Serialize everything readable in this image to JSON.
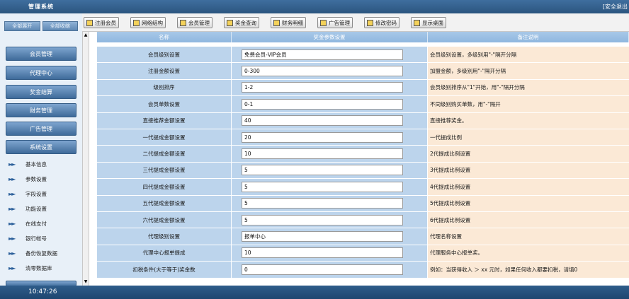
{
  "app": {
    "title": "管理系统",
    "logout": "[安全退出"
  },
  "left_top_buttons": [
    "全部展开",
    "全部收缩"
  ],
  "menu": [
    "会员管理",
    "代理中心",
    "奖金结算",
    "财务管理",
    "广告管理",
    "系统设置"
  ],
  "submenu": [
    "基本信息",
    "参数设置",
    "字段设置",
    "功能设置",
    "在线支付",
    "银行帐号",
    "备份恢复数据",
    "清零数据库"
  ],
  "toolbar": [
    "注册会员",
    "网络结构",
    "会员管理",
    "奖金查询",
    "财务明细",
    "广告管理",
    "修改密码",
    "显示桌面"
  ],
  "table": {
    "headers": [
      "名称",
      "奖金参数设置",
      "备注说明"
    ],
    "rows": [
      {
        "name": "会员级别设置",
        "value": "免费会员-VIP会员",
        "note": "会员级别设置，多级别用\"-\"隔开分隔"
      },
      {
        "name": "注册金额设置",
        "value": "0-300",
        "note": "加盟金额，多级别用\"-\"隔开分隔"
      },
      {
        "name": "级别排序",
        "value": "1-2",
        "note": "会员级别排序从\"1\"开始，用\"-\"隔开分隔"
      },
      {
        "name": "会员单数设置",
        "value": "0-1",
        "note": "不同级别购买单数，用\"-\"隔开"
      },
      {
        "name": "直接推荐金额设置",
        "value": "40",
        "note": "直接推荐奖金。"
      },
      {
        "name": "一代提成金额设置",
        "value": "20",
        "note": "一代提成比例"
      },
      {
        "name": "二代提成金额设置",
        "value": "10",
        "note": "2代提成比例设置"
      },
      {
        "name": "三代提成金额设置",
        "value": "5",
        "note": "3代提成比例设置"
      },
      {
        "name": "四代提成金额设置",
        "value": "5",
        "note": "4代提成比例设置"
      },
      {
        "name": "五代提成金额设置",
        "value": "5",
        "note": "5代提成比例设置"
      },
      {
        "name": "六代提成金额设置",
        "value": "5",
        "note": "6代提成比例设置"
      },
      {
        "name": "代理级别设置",
        "value": "报单中心",
        "note": "代理名称设置"
      },
      {
        "name": "代理中心报单提成",
        "value": "10",
        "note": "代理服务中心报单奖。"
      },
      {
        "name": "扣税条件(大于等于)奖金数",
        "value": "0",
        "note": "例如：当获得收入 ＞ xx 元时，如果任何收入都要扣税，请填0"
      }
    ]
  },
  "status": {
    "clock": "10:47:26"
  }
}
